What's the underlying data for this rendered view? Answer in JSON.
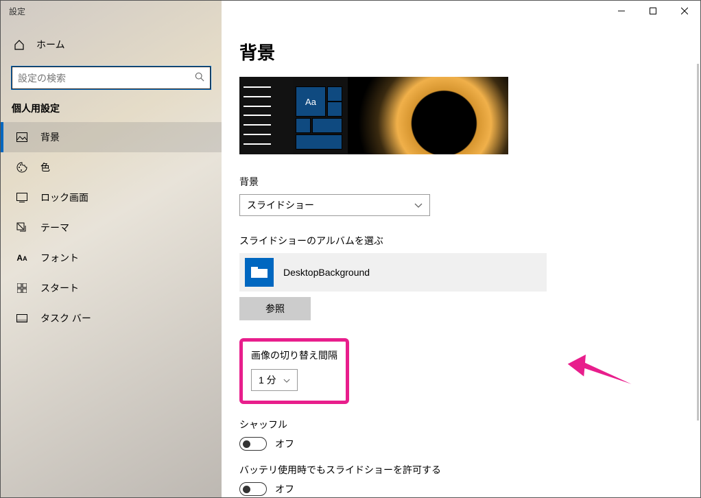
{
  "titlebar": {
    "title": "設定"
  },
  "sidebar": {
    "home": "ホーム",
    "searchPlaceholder": "設定の検索",
    "group": "個人用設定",
    "items": [
      {
        "label": "背景"
      },
      {
        "label": "色"
      },
      {
        "label": "ロック画面"
      },
      {
        "label": "テーマ"
      },
      {
        "label": "フォント"
      },
      {
        "label": "スタート"
      },
      {
        "label": "タスク バー"
      }
    ]
  },
  "main": {
    "title": "背景",
    "previewAa": "Aa",
    "bgLabel": "背景",
    "bgValue": "スライドショー",
    "albumLabel": "スライドショーのアルバムを選ぶ",
    "albumName": "DesktopBackground",
    "browse": "参照",
    "intervalLabel": "画像の切り替え間隔",
    "intervalValue": "1 分",
    "shuffleLabel": "シャッフル",
    "shuffleState": "オフ",
    "batteryLabel": "バッテリ使用時でもスライドショーを許可する",
    "batteryState": "オフ"
  }
}
